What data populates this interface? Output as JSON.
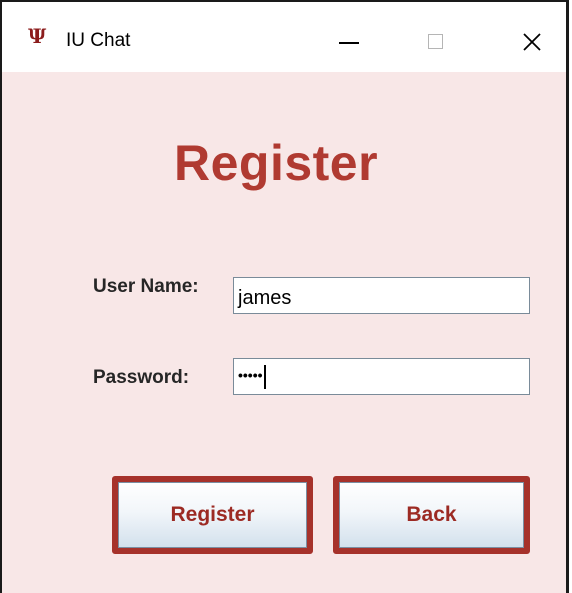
{
  "window": {
    "title": "IU Chat",
    "icon": "trident-icon"
  },
  "main": {
    "heading": "Register",
    "username_label": "User Name:",
    "username_value": "james",
    "password_label": "Password:",
    "password_value": "•••••"
  },
  "buttons": {
    "register_label": "Register",
    "back_label": "Back"
  },
  "colors": {
    "accent": "#b03a31",
    "background": "#f8e7e7",
    "button_border": "#a6322b"
  }
}
